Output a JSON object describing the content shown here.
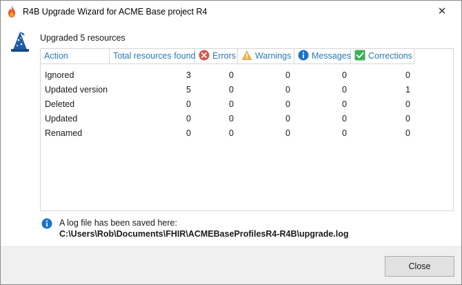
{
  "window": {
    "title": "R4B Upgrade Wizard for ACME Base project R4",
    "close_glyph": "✕"
  },
  "summary": "Upgraded 5 resources",
  "table": {
    "columns": [
      {
        "label": "Action",
        "icon": null
      },
      {
        "label": "Total resources found",
        "icon": null
      },
      {
        "label": "Errors",
        "icon": "error-icon"
      },
      {
        "label": "Warnings",
        "icon": "warning-icon"
      },
      {
        "label": "Messages",
        "icon": "info-icon"
      },
      {
        "label": "Corrections",
        "icon": "check-icon"
      }
    ],
    "rows": [
      {
        "action": "Ignored",
        "total": "3",
        "errors": "0",
        "warnings": "0",
        "messages": "0",
        "corrections": "0"
      },
      {
        "action": "Updated version",
        "total": "5",
        "errors": "0",
        "warnings": "0",
        "messages": "0",
        "corrections": "1"
      },
      {
        "action": "Deleted",
        "total": "0",
        "errors": "0",
        "warnings": "0",
        "messages": "0",
        "corrections": "0"
      },
      {
        "action": "Updated",
        "total": "0",
        "errors": "0",
        "warnings": "0",
        "messages": "0",
        "corrections": "0"
      },
      {
        "action": "Renamed",
        "total": "0",
        "errors": "0",
        "warnings": "0",
        "messages": "0",
        "corrections": "0"
      }
    ]
  },
  "log": {
    "message": "A log file has been saved here:",
    "path": "C:\\Users\\Rob\\Documents\\FHIR\\ACMEBaseProfilesR4-R4B\\upgrade.log"
  },
  "buttons": {
    "close_label": "Close"
  },
  "colors": {
    "header_text": "#2a7ab3",
    "error": "#d9534f",
    "warning": "#f0ad4e",
    "info": "#1a73c9",
    "correction": "#3cb054"
  }
}
